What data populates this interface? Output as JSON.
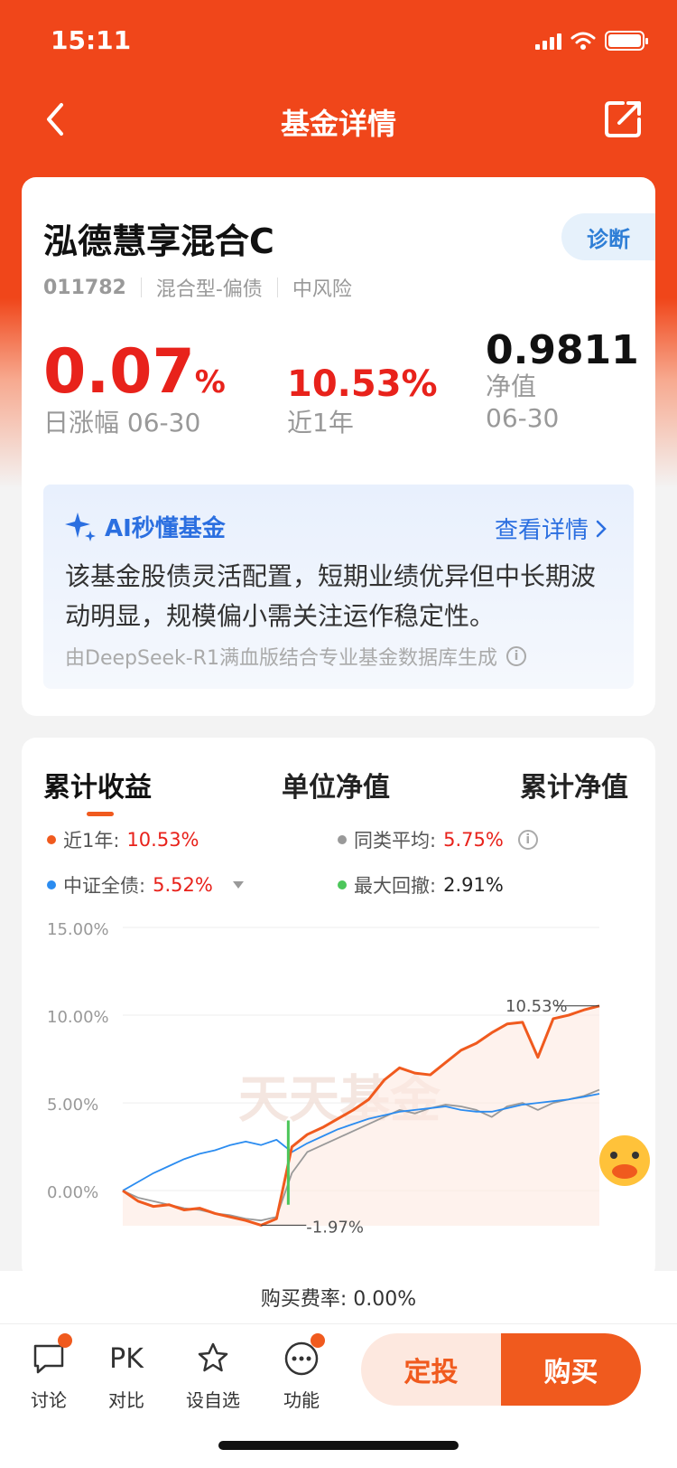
{
  "status": {
    "time": "15:11"
  },
  "nav": {
    "title": "基金详情"
  },
  "fund": {
    "name": "泓德慧享混合C",
    "diagnose_label": "诊断",
    "code": "011782",
    "type": "混合型-偏债",
    "risk": "中风险",
    "daily_change_num": "0.07",
    "daily_change_pct": "%",
    "daily_change_label": "日涨幅 06-30",
    "year_return": "10.53%",
    "year_return_label": "近1年",
    "nav_value": "0.9811",
    "nav_label": "净值",
    "nav_date": "06-30"
  },
  "ai": {
    "title": "AI秒懂基金",
    "more": "查看详情",
    "summary": "该基金股债灵活配置，短期业绩优异但中长期波动明显，规模偏小需关注运作稳定性。",
    "source": "由DeepSeek-R1满血版结合专业基金数据库生成"
  },
  "chart_tabs": [
    "累计收益",
    "单位净值",
    "累计净值"
  ],
  "legend": {
    "year": {
      "label": "近1年:",
      "value": "10.53%",
      "color": "#f05a1e"
    },
    "peer": {
      "label": "同类平均:",
      "value": "5.75%",
      "color": "#999999"
    },
    "index": {
      "label": "中证全债:",
      "value": "5.52%",
      "color": "#2b8cf0"
    },
    "drawdown": {
      "label": "最大回撤:",
      "value": "2.91%",
      "color": "#4cc65a"
    }
  },
  "chart_data": {
    "type": "line",
    "y_ticks": [
      "15.00%",
      "10.00%",
      "5.00%",
      "0.00%"
    ],
    "ylim": [
      -2,
      15
    ],
    "grid": true,
    "annotations": [
      "10.53%",
      "-1.97%"
    ],
    "watermark": "天天基金",
    "series": [
      {
        "name": "近1年",
        "color": "#f05a1e",
        "values": [
          0,
          -0.6,
          -0.9,
          -0.8,
          -1.1,
          -1.0,
          -1.3,
          -1.5,
          -1.7,
          -1.97,
          -1.6,
          2.5,
          3.2,
          3.6,
          4.1,
          4.6,
          5.2,
          6.3,
          7.0,
          6.7,
          6.6,
          7.3,
          8.0,
          8.4,
          9.0,
          9.5,
          9.6,
          7.6,
          9.8,
          10.0,
          10.3,
          10.53
        ]
      },
      {
        "name": "同类平均",
        "color": "#999999",
        "values": [
          0,
          -0.4,
          -0.6,
          -0.8,
          -1.0,
          -1.1,
          -1.3,
          -1.4,
          -1.6,
          -1.7,
          -1.5,
          1.0,
          2.2,
          2.6,
          3.0,
          3.4,
          3.8,
          4.2,
          4.6,
          4.4,
          4.7,
          4.9,
          4.8,
          4.6,
          4.2,
          4.8,
          5.0,
          4.6,
          5.0,
          5.2,
          5.4,
          5.75
        ]
      },
      {
        "name": "中证全债",
        "color": "#2b8cf0",
        "values": [
          0,
          0.5,
          1.0,
          1.4,
          1.8,
          2.1,
          2.3,
          2.6,
          2.8,
          2.6,
          2.9,
          2.2,
          2.7,
          3.1,
          3.5,
          3.8,
          4.1,
          4.3,
          4.5,
          4.6,
          4.7,
          4.8,
          4.6,
          4.5,
          4.5,
          4.7,
          4.9,
          5.0,
          5.1,
          5.2,
          5.35,
          5.52
        ]
      }
    ]
  },
  "fee": "购买费率: 0.00%",
  "bottom": {
    "discuss": "讨论",
    "pk_icon": "PK",
    "compare": "对比",
    "watchlist": "设自选",
    "functions": "功能",
    "dingtou": "定投",
    "buy": "购买"
  }
}
